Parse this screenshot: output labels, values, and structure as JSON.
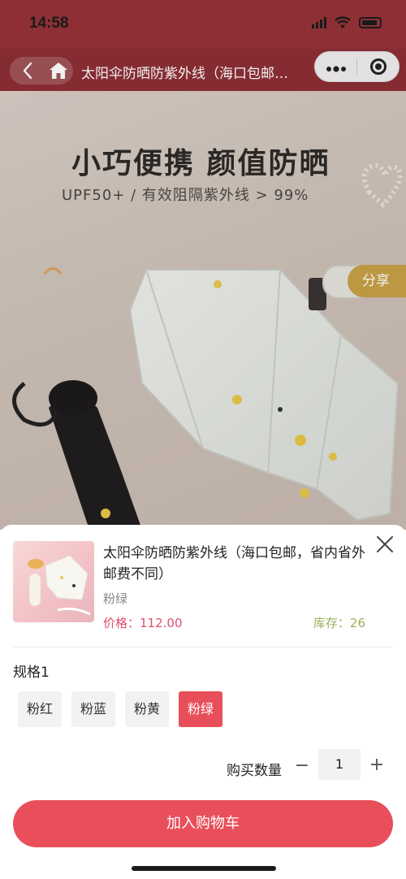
{
  "status": {
    "time": "14:58"
  },
  "nav": {
    "title": "太阳伞防晒防紫外线（海口包邮…"
  },
  "hero": {
    "headline": "小巧便携  颜值防晒",
    "subline": "UPF50+  /  有效阻隔紫外线 > 99%",
    "share": "分享"
  },
  "product": {
    "title": "太阳伞防晒防紫外线（海口包邮，省内省外邮费不同）",
    "variant": "粉绿",
    "price": "价格：112.00",
    "stock": "库存：26"
  },
  "spec": {
    "label": "规格1",
    "options": [
      "粉红",
      "粉蓝",
      "粉黄",
      "粉绿"
    ],
    "selected": "粉绿"
  },
  "quantity": {
    "label": "购买数量",
    "value": "1",
    "minus": "−",
    "plus": "+"
  },
  "cart": {
    "button_label": "加入购物车"
  },
  "colors": {
    "brand": "#8e2f36",
    "accent": "#e84f5a",
    "price": "#e04f6e",
    "stock": "#9ab05a"
  }
}
